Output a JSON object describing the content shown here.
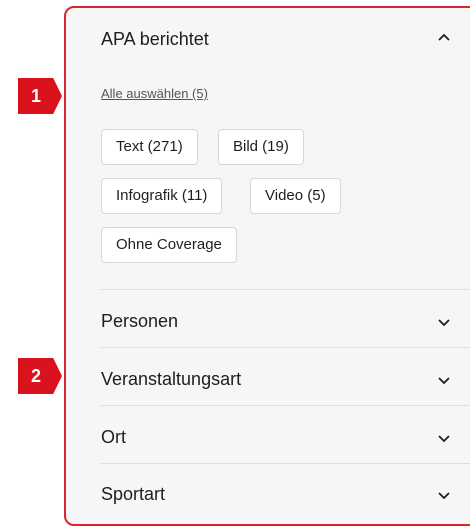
{
  "filter_panel": {
    "apa_section": {
      "title": "APA berichtet",
      "select_all": "Alle auswählen (5)",
      "chips": [
        "Text (271)",
        "Bild (19)",
        "Infografik (11)",
        "Video (5)",
        "Ohne Coverage"
      ]
    },
    "sections": [
      {
        "title": "Personen"
      },
      {
        "title": "Veranstaltungsart"
      },
      {
        "title": "Ort"
      },
      {
        "title": "Sportart"
      }
    ]
  },
  "markers": [
    "1",
    "2"
  ],
  "colors": {
    "accent": "#d9121e",
    "panel_border": "#d9252f",
    "panel_bg": "#f6f6f6"
  },
  "icons": {
    "expanded": "chevron-up-icon",
    "collapsed": "chevron-down-icon"
  }
}
